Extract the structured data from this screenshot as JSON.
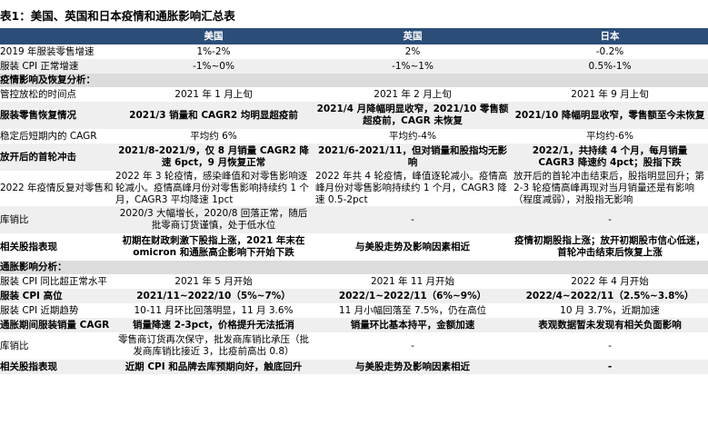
{
  "title": "表1：美国、英国和日本疫情和通胀影响汇总表",
  "columns": [
    "",
    "美国",
    "英国",
    "日本"
  ],
  "rows": [
    {
      "type": "row",
      "style": "r1",
      "cells": [
        "2019 年服装零售增速",
        "1%-2%",
        "2%",
        "-0.2%"
      ]
    },
    {
      "type": "row",
      "style": "r1 alt",
      "cells": [
        "服装 CPI 正常增速",
        "-1%~0%",
        "-1%~1%",
        "0.5%-1%"
      ]
    },
    {
      "type": "section",
      "label": "疫情影响及恢复分析："
    },
    {
      "type": "row",
      "style": "r1",
      "cells": [
        "管控放松的时间点",
        "2021 年 1 月上旬",
        "2021 年 2 月上旬",
        "2021 年 9 月上旬"
      ]
    },
    {
      "type": "row",
      "style": "r2 bold alt",
      "cells": [
        "服装零售恢复情况",
        "2021/3 销量和 CAGR2 均明显超疫前",
        "2021/4 月降幅明显收窄，2021/10 零售额超疫前，CAGR 未恢复",
        "2021/10 降幅明显收窄，零售额至今未恢复"
      ]
    },
    {
      "type": "row",
      "style": "r1",
      "cells": [
        "稳定后短期内的 CAGR",
        "平均约 6%",
        "平均约-4%",
        "平均约-6%"
      ]
    },
    {
      "type": "row",
      "style": "r2 bold alt",
      "cells": [
        "放开后的首轮冲击",
        "2021/8-2021/9，仅 8 月销量 CAGR2 降速 6pct，9 月恢复正常",
        "2021/6-2021/11，但对销量和股指均无影响",
        "2022/1，共持续 4 个月，每月销量 CAGR3 降速约 4pct；股指下跌"
      ]
    },
    {
      "type": "row",
      "style": "r2 just",
      "cells": [
        "2022 年疫情反复对零售和股指的影响",
        "2022 年 3 轮疫情，感染峰值和对零售影响逐轮减小。疫情高峰月份对零售影响持续约 1 个月，CAGR3 平均降速 1pct",
        "2022 年共 4 轮疫情，峰值逐轮减小。疫情高峰月份对零售影响持续约 1 个月，CAGR3 降速 0.5-2pct",
        "放开后的首轮冲击结束后，股指明显回升；第 2-3 轮疫情高峰再现对当月销量还是有影响（程度减弱），对股指无影响"
      ]
    },
    {
      "type": "row",
      "style": "r2 alt",
      "cells": [
        "库销比",
        "2020/3 大幅增长，2020/8 回落正常，随后批零商订货谨慎，处于低水位",
        "-",
        "-"
      ]
    },
    {
      "type": "row",
      "style": "r2 bold",
      "cells": [
        "相关股指表现",
        "初期在财政刺激下股指上涨，2021 年末在 omicron 和通胀高企影响下开始下跌",
        "与美股走势及影响因素相近",
        "疫情初期股指上涨；放开初期股市信心低迷，首轮冲击结束后恢复上涨"
      ]
    },
    {
      "type": "section",
      "label": "通胀影响分析："
    },
    {
      "type": "row",
      "style": "r1",
      "cells": [
        "服装 CPI 同比超正常水平",
        "2021 年 5 月开始",
        "2021 年 11 月开始",
        "2022 年 4 月开始"
      ]
    },
    {
      "type": "row",
      "style": "r1 bold alt",
      "cells": [
        "服装 CPI 高位",
        "2021/11~2022/10（5%~7%）",
        "2022/1~2022/11（6%~9%）",
        "2022/4~2022/11（2.5%~3.8%）"
      ]
    },
    {
      "type": "row",
      "style": "r1",
      "cells": [
        "服装 CPI 近期趋势",
        "10-11 月环比回落明显，11 月 3.6%",
        "11 月小幅回落至 7.5%，仍在高位",
        "10 月 3.7%，近期加速"
      ]
    },
    {
      "type": "row",
      "style": "r1 bold alt",
      "cells": [
        "通胀期间服装销量 CAGR",
        "销量降速 2-3pct，价格提升无法抵消",
        "销量环比基本持平，金额加速",
        "表观数据暂未发现有相关负面影响"
      ]
    },
    {
      "type": "row",
      "style": "r2",
      "cells": [
        "库销比",
        "零售商订货再次保守，批发商库销比承压（批发商库销比接近 3，比疫前高出 0.8）",
        "-",
        "-"
      ]
    },
    {
      "type": "row",
      "style": "r1 bold alt",
      "cells": [
        "相关股指表现",
        "近期 CPI 和品牌去库预期向好，触底回升",
        "与美股走势及影响因素相近",
        "-"
      ]
    }
  ]
}
